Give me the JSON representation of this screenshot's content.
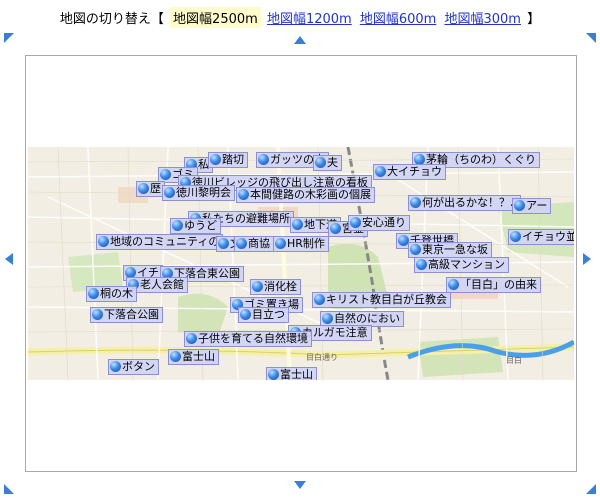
{
  "switch": {
    "label": "地図の切り替え【",
    "current": "地図幅2500m",
    "options": [
      "地図幅1200m",
      "地図幅600m",
      "地図幅300m"
    ],
    "close": "】"
  },
  "icons": {
    "pan_up": "arrow-up-icon",
    "pan_down": "arrow-down-icon",
    "pan_left": "arrow-left-icon",
    "pan_right": "arrow-right-icon",
    "pan_ul": "arrow-up-left-icon",
    "pan_ur": "arrow-up-right-icon",
    "pan_dl": "arrow-down-left-icon",
    "pan_dr": "arrow-down-right-icon",
    "marker": "blue-ball-marker-icon"
  },
  "colors": {
    "arrow": "#3a7fd5",
    "pin_bg": "#d0d2f6",
    "link": "#2233cc",
    "current_bg": "#fffbcc"
  },
  "map": {
    "road_labels": [
      "目白通り",
      "目白"
    ],
    "markers": [
      "私",
      "踏切",
      "ガッツの木",
      "夫",
      "茅輪（ちのわ）くぐり",
      "大イチョウ",
      "ゴミ",
      "徳川ビレッジの飛び出し注意の看板",
      "歴",
      "徳川黎明会",
      "本間健路の木彩画の個展",
      "何が出るかな！？♪",
      "アー",
      "私たちの避難場所",
      "地下道",
      "宮金",
      "安心通り",
      "ゆうど",
      "地域のコミュニティの",
      "文",
      "商協",
      "HR制作",
      "千登世橋",
      "イチョウ並",
      "東京一急な坂",
      "高級マンション",
      "イチ",
      "下落合東公園",
      "老人会館",
      "桐の木",
      "消化栓",
      "「目白」の由来",
      "キリスト教目白が丘教会",
      "ゴミ置き場",
      "下落合公園",
      "自然のにおい",
      "目立つ",
      "カルガモ注意",
      "子供を育てる自然環境",
      "富士山",
      "ボタン",
      "富士山"
    ]
  }
}
